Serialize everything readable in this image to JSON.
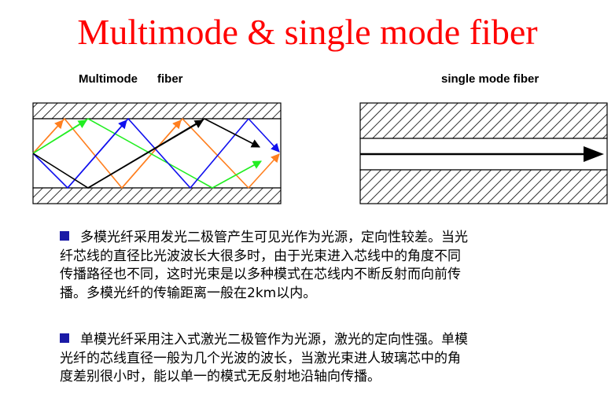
{
  "slide": {
    "title": "Multimode & single mode fiber",
    "title_color": "#ff0000"
  },
  "diagrams": {
    "multimode_label": "Multimode      fiber",
    "single_mode_label": "single mode fiber",
    "ray_colors": {
      "orange": "#ff7f1f",
      "green": "#22ee22",
      "blue": "#1010ee",
      "black": "#000000"
    }
  },
  "paragraphs": [
    {
      "bullet_color": "#1a1aa6",
      "lines": [
        "多模光纤采用发光二极管产生可见光作为光源，定向性较差。当光",
        "纤芯线的直径比光波波长大很多时，由于光束进入芯线中的角度不同",
        "传播路径也不同，这时光束是以多种模式在芯线内不断反射而向前传",
        "播。多模光纤的传输距离一般在2km以内。"
      ]
    },
    {
      "bullet_color": "#1a1aa6",
      "lines": [
        "单模光纤采用注入式激光二极管作为光源，激光的定向性强。单模",
        "光纤的芯线直径一般为几个光波的波长，当激光束进人玻璃芯中的角",
        "度差别很小时，能以单一的模式无反射地沿轴向传播。"
      ]
    }
  ]
}
